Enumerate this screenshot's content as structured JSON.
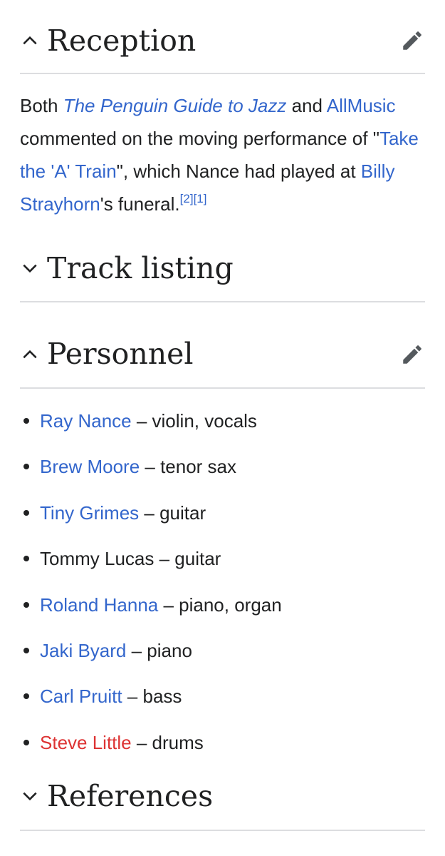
{
  "sections": {
    "reception": {
      "title": "Reception",
      "expanded": true,
      "editable": true
    },
    "track_listing": {
      "title": "Track listing",
      "expanded": false
    },
    "personnel": {
      "title": "Personnel",
      "expanded": true,
      "editable": true
    },
    "references": {
      "title": "References",
      "expanded": false
    }
  },
  "reception_text": {
    "t1": "Both ",
    "penguin": "The Penguin Guide to Jazz",
    "t2": " and ",
    "allmusic": "AllMusic",
    "t3": " commented on the moving performance of \"",
    "train": "Take the 'A' Train",
    "t4": "\", which Nance had played at ",
    "strayhorn": "Billy Strayhorn",
    "t5": "'s funeral.",
    "ref2": "[2]",
    "ref1": "[1]"
  },
  "personnel": [
    {
      "name": "Ray Nance",
      "role": " – violin, vocals"
    },
    {
      "name": "Brew Moore",
      "role": " – tenor sax"
    },
    {
      "name": "Tiny Grimes",
      "role": " – guitar"
    },
    {
      "name": "Tommy Lucas",
      "role": " – guitar"
    },
    {
      "name": "Roland Hanna",
      "role": " – piano, organ"
    },
    {
      "name": "Jaki Byard",
      "role": " – piano"
    },
    {
      "name": "Carl Pruitt",
      "role": " – bass"
    },
    {
      "name": "Steve Little",
      "role": " – drums"
    }
  ],
  "colors": {
    "link": "#3366cc",
    "redlink": "#dd3333",
    "text": "#202122",
    "divider": "#dcdde0",
    "icon": "#54595d"
  },
  "icons": {
    "collapse": "chevron-up-icon",
    "expand": "chevron-down-icon",
    "edit": "pencil-icon"
  }
}
